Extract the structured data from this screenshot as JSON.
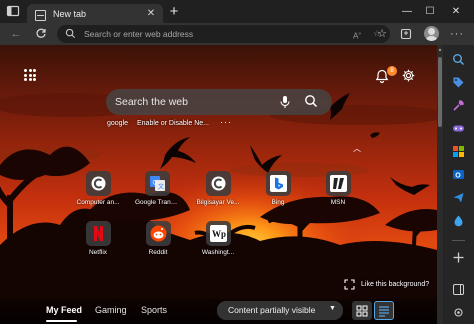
{
  "browser": {
    "tab_title": "New tab",
    "address_placeholder": "Search or enter web address"
  },
  "ntp": {
    "search_placeholder": "Search the web",
    "notification_count": "8",
    "quick_searches": [
      "google",
      "Enable or Disable Ne..."
    ],
    "tiles": [
      {
        "label": "Computer an...",
        "icon": "c-logo-icon",
        "color": "#ffffff"
      },
      {
        "label": "Google Trans...",
        "icon": "google-translate-icon",
        "color": "#4285f4"
      },
      {
        "label": "Bilgisayar Ve...",
        "icon": "c-logo-icon",
        "color": "#ffffff"
      },
      {
        "label": "Bing",
        "icon": "bing-icon",
        "color": "#1a73e8"
      },
      {
        "label": "MSN",
        "icon": "msn-icon",
        "color": "#ffffff"
      },
      {
        "label": "Netflix",
        "icon": "netflix-icon",
        "color": "#e50914"
      },
      {
        "label": "Reddit",
        "icon": "reddit-icon",
        "color": "#ff4500"
      },
      {
        "label": "Washingt...",
        "icon": "washington-post-icon",
        "color": "#ffffff"
      }
    ],
    "like_background": "Like this background?",
    "feed_tabs": [
      "My Feed",
      "Gaming",
      "Sports"
    ],
    "content_visibility": "Content partially visible"
  },
  "colors": {
    "accent": "#5aa7e6",
    "badge": "#ff8a2b",
    "sky_top": "#3a1208",
    "sky_mid": "#c4300e",
    "sun": "#ffb020"
  }
}
